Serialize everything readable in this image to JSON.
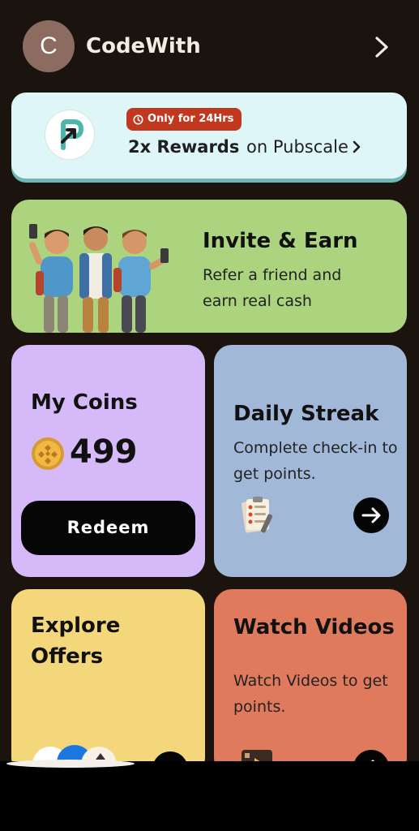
{
  "header": {
    "avatar_initial": "C",
    "username": "CodeWith"
  },
  "promo": {
    "badge": "Only for 24Hrs",
    "title_bold": "2x Rewards",
    "title_rest": " on Pubscale",
    "brand_color": "#c2381f",
    "accent": "#4ab7a8"
  },
  "cards": {
    "invite": {
      "title": "Invite & Earn",
      "desc": "Refer a friend and earn real cash",
      "color": "#acd47f"
    },
    "coins": {
      "title": "My Coins",
      "value": "499",
      "button": "Redeem",
      "color": "#d6b9f9"
    },
    "streak": {
      "title": "Daily Streak",
      "desc": "Complete check-in to get points.",
      "color": "#a2b8d8"
    },
    "offers": {
      "title": "Explore Offers",
      "color": "#f3d77a"
    },
    "videos": {
      "title": "Watch Videos",
      "desc": "Watch Videos to get points.",
      "color": "#df7a5d"
    }
  },
  "icons": {
    "header": "chevron-right-icon",
    "promo_logo": "pubscale-logo-icon",
    "badge": "clock-icon",
    "coin": "coin-icon",
    "streak": "checklist-icon",
    "videos": "video-clip-icon",
    "arrow": "arrow-right-icon"
  }
}
